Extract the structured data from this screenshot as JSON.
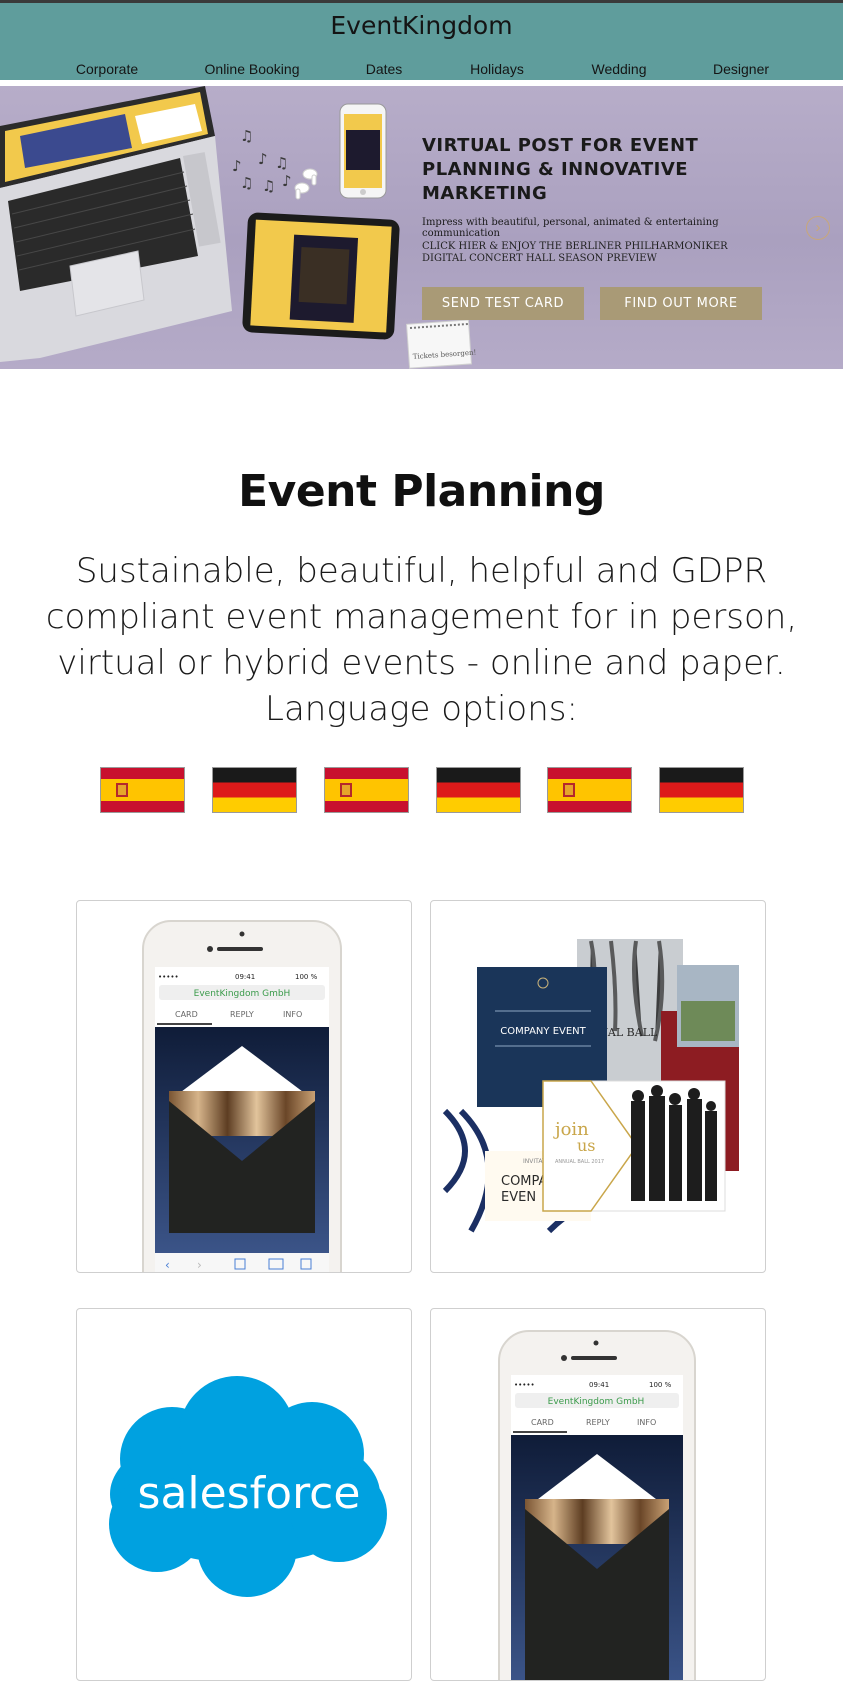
{
  "header": {
    "brand": "EventKingdom",
    "nav": [
      "Corporate",
      "Online Booking",
      "Dates",
      "Holidays",
      "Wedding",
      "Designer"
    ]
  },
  "hero": {
    "title": "VIRTUAL POST FOR EVENT PLANNING & INNOVATIVE MARKETING",
    "subtitle": "Impress with beautiful, personal, animated & entertaining communication",
    "link": "CLICK HIER & ENJOY THE BERLINER PHILHARMONIKER DIGITAL CONCERT HALL SEASON PREVIEW",
    "buttons": [
      "SEND TEST CARD",
      "FIND OUT MORE"
    ],
    "note": "Tickets besorgen!",
    "next_icon": "chevron-right-icon"
  },
  "section": {
    "title": "Event Planning",
    "description": "Sustainable, beautiful, helpful and GDPR compliant event management for in person, virtual or hybrid events - online and paper. Language options:"
  },
  "flags": [
    "es",
    "de",
    "es",
    "de",
    "es",
    "de"
  ],
  "cards": {
    "phone": {
      "time": "09:41",
      "battery": "100 %",
      "url": "EventKingdom GmbH",
      "tabs": [
        "CARD",
        "REPLY",
        "INFO"
      ]
    },
    "invitations": {
      "company_event": "COMPANY EVENT",
      "ball": "UAL BALL",
      "comp": "COMPA",
      "even": "EVEN",
      "invitation": "INVITATION",
      "join": "join",
      "us": "us",
      "annual_ball": "ANNUAL BALL 2017"
    },
    "salesforce": {
      "logo_text": "salesforce"
    }
  },
  "colors": {
    "header_bg": "#5f9d9c",
    "hero_bg": "#aaa0bf",
    "button_bg": "#a99a76",
    "salesforce_blue": "#00a1e0"
  }
}
